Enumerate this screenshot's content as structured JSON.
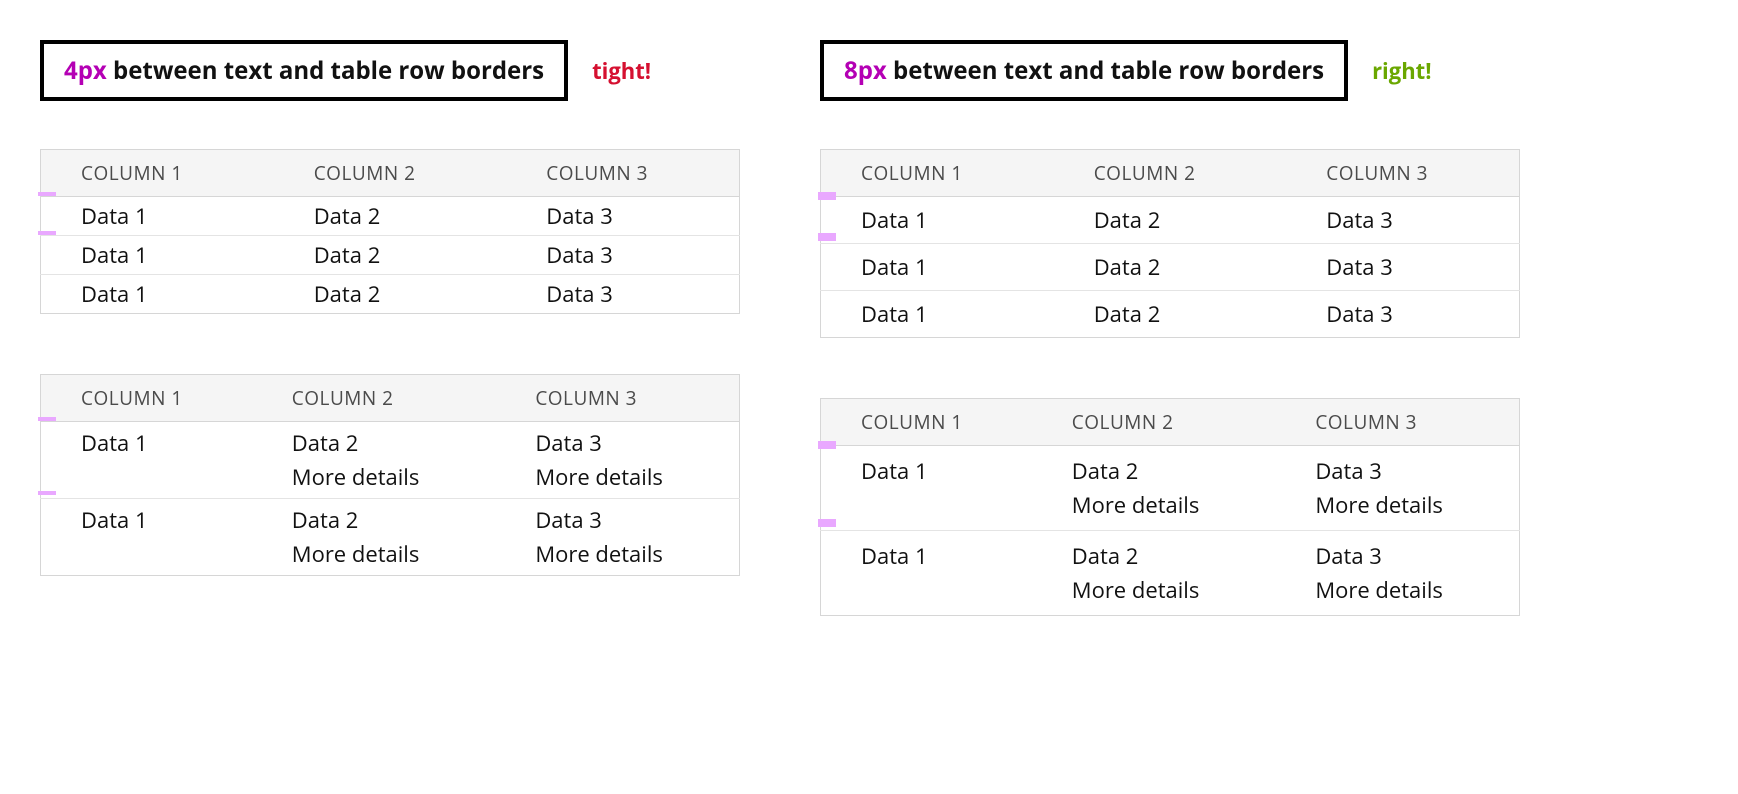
{
  "left": {
    "heading_px": "4px",
    "heading_rest": " between text and table row borders",
    "note": "tight!"
  },
  "right": {
    "heading_px": "8px",
    "heading_rest": " between text and table row borders",
    "note": "right!"
  },
  "table_simple": {
    "headers": [
      "COLUMN 1",
      "COLUMN 2",
      "COLUMN 3"
    ],
    "rows": [
      [
        "Data 1",
        "Data 2",
        "Data 3"
      ],
      [
        "Data 1",
        "Data 2",
        "Data 3"
      ],
      [
        "Data 1",
        "Data 2",
        "Data 3"
      ]
    ]
  },
  "table_detail": {
    "headers": [
      "COLUMN 1",
      "COLUMN 2",
      "COLUMN 3"
    ],
    "rows": [
      [
        [
          "Data 1"
        ],
        [
          "Data 2",
          "More details"
        ],
        [
          "Data 3",
          "More details"
        ]
      ],
      [
        [
          "Data 1"
        ],
        [
          "Data 2",
          "More details"
        ],
        [
          "Data 3",
          "More details"
        ]
      ]
    ]
  }
}
